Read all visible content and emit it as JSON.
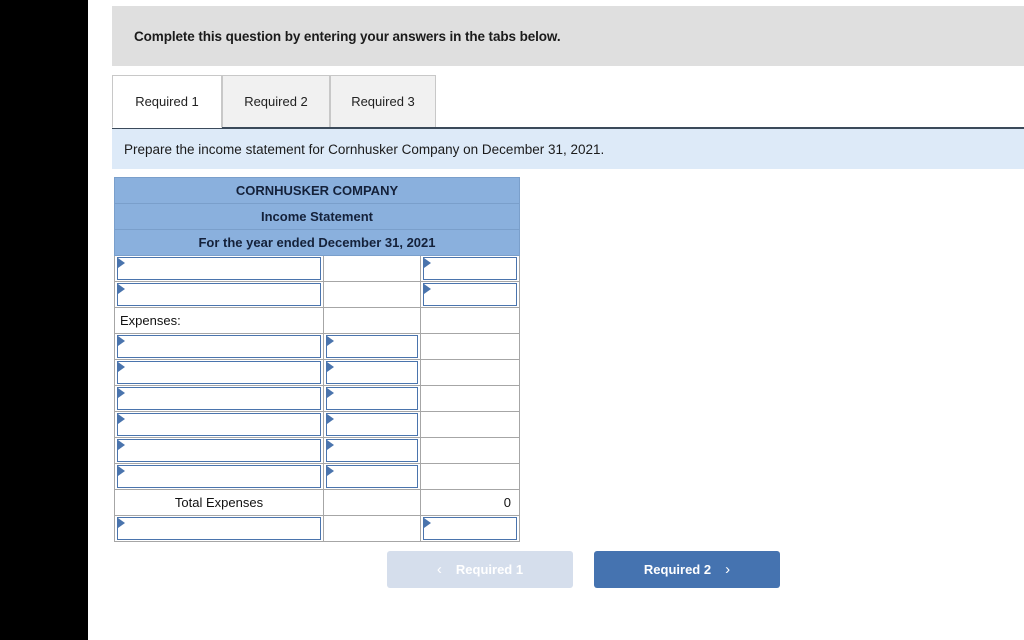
{
  "banner": {
    "text": "Complete this question by entering your answers in the tabs below."
  },
  "tabs": [
    {
      "label": "Required 1",
      "active": true
    },
    {
      "label": "Required 2",
      "active": false
    },
    {
      "label": "Required 3",
      "active": false
    }
  ],
  "prompt": {
    "text": "Prepare the income statement for Cornhusker Company on December 31, 2021."
  },
  "worksheet": {
    "title_lines": [
      "CORNHUSKER COMPANY",
      "Income Statement",
      "For the year ended December 31, 2021"
    ],
    "rows": [
      {
        "type": "entry",
        "a": "",
        "b": "",
        "c": "",
        "a_combo": true,
        "b_combo": false,
        "c_combo": true
      },
      {
        "type": "entry",
        "a": "",
        "b": "",
        "c": "",
        "a_combo": true,
        "b_combo": false,
        "c_combo": true
      },
      {
        "type": "label",
        "a": "Expenses:",
        "b": "",
        "c": "",
        "align": "left"
      },
      {
        "type": "entry",
        "a": "",
        "b": "",
        "c": "",
        "a_combo": true,
        "b_combo": true,
        "c_combo": false
      },
      {
        "type": "entry",
        "a": "",
        "b": "",
        "c": "",
        "a_combo": true,
        "b_combo": true,
        "c_combo": false
      },
      {
        "type": "entry",
        "a": "",
        "b": "",
        "c": "",
        "a_combo": true,
        "b_combo": true,
        "c_combo": false
      },
      {
        "type": "entry",
        "a": "",
        "b": "",
        "c": "",
        "a_combo": true,
        "b_combo": true,
        "c_combo": false
      },
      {
        "type": "entry",
        "a": "",
        "b": "",
        "c": "",
        "a_combo": true,
        "b_combo": true,
        "c_combo": false
      },
      {
        "type": "entry",
        "a": "",
        "b": "",
        "c": "",
        "a_combo": true,
        "b_combo": true,
        "c_combo": false
      },
      {
        "type": "total",
        "a": "Total Expenses",
        "b": "",
        "c": "0",
        "align": "center"
      },
      {
        "type": "entry",
        "a": "",
        "b": "",
        "c": "",
        "a_combo": true,
        "b_combo": false,
        "c_combo": true
      }
    ],
    "total_expenses_label": "Total Expenses",
    "total_expenses_value": "0",
    "expenses_label": "Expenses:"
  },
  "nav": {
    "prev_label": "Required 1",
    "prev_icon": "chevron-left-icon",
    "prev_disabled": true,
    "next_label": "Required 2",
    "next_icon": "chevron-right-icon"
  },
  "colors": {
    "header_blue": "#8ab0dd",
    "prompt_blue": "#ddeaf8",
    "banner_gray": "#dfdfdf",
    "button_blue": "#4573b0",
    "button_disabled": "#d5deec",
    "combo_border": "#4a74ad"
  }
}
